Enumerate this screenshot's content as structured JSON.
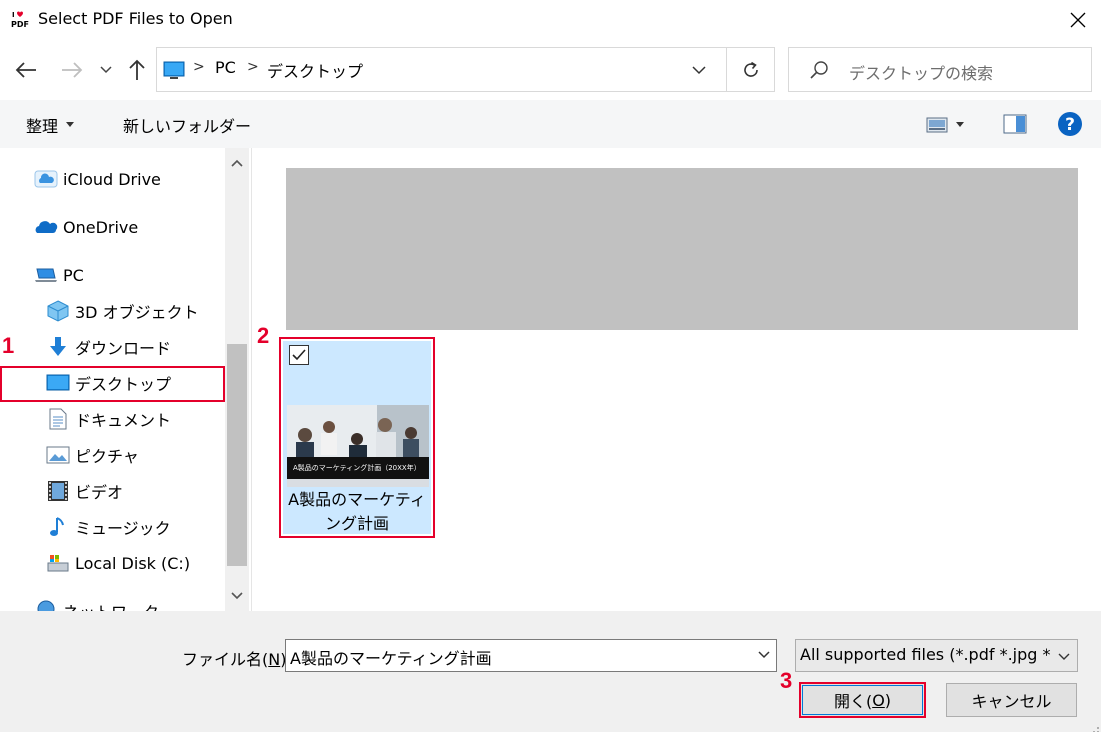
{
  "window": {
    "title": "Select PDF Files to Open",
    "app_icon_text": "PDF"
  },
  "address_bar": {
    "segments": [
      "PC",
      "デスクトップ"
    ]
  },
  "search": {
    "placeholder": "デスクトップの検索"
  },
  "toolbar": {
    "organize_label": "整理",
    "new_folder_label": "新しいフォルダー"
  },
  "nav_pane": {
    "items": [
      {
        "label": "iCloud Drive",
        "icon": "icloud-icon"
      },
      {
        "label": "OneDrive",
        "icon": "onedrive-icon"
      },
      {
        "label": "PC",
        "icon": "pc-icon"
      },
      {
        "label": "3D オブジェクト",
        "icon": "3d-objects-icon"
      },
      {
        "label": "ダウンロード",
        "icon": "download-icon"
      },
      {
        "label": "デスクトップ",
        "icon": "desktop-icon",
        "selected": true
      },
      {
        "label": "ドキュメント",
        "icon": "documents-icon"
      },
      {
        "label": "ピクチャ",
        "icon": "pictures-icon"
      },
      {
        "label": "ビデオ",
        "icon": "videos-icon"
      },
      {
        "label": "ミュージック",
        "icon": "music-icon"
      },
      {
        "label": "Local Disk (C:)",
        "icon": "local-disk-icon"
      },
      {
        "label": "ネットワーク",
        "icon": "network-icon"
      }
    ]
  },
  "content": {
    "files": [
      {
        "name": "A製品のマーケティング計画",
        "name_line1": "A製品のマーケティ",
        "name_line2": "ング計画",
        "thumbnail_caption": "A製品のマーケティング計画（20XX年）",
        "selected": true,
        "checked": true
      }
    ]
  },
  "bottom": {
    "filename_label": "ファイル名(N):",
    "filename_label_main": "ファイル名(",
    "filename_label_accel": "N",
    "filename_label_end": "):",
    "filename_value": "A製品のマーケティング計画",
    "filetype_value": "All supported files (*.pdf *.jpg *",
    "open_label_main": "開く(",
    "open_label_accel": "O",
    "open_label_end": ")",
    "cancel_label": "キャンセル"
  },
  "annotations": {
    "step1": "1",
    "step2": "2",
    "step3": "3"
  },
  "colors": {
    "annotation_red": "#e4002b",
    "selection_blue": "#cce8ff",
    "toolbar_bg": "#f5f6f7",
    "bottom_bg": "#f0f0f0"
  }
}
